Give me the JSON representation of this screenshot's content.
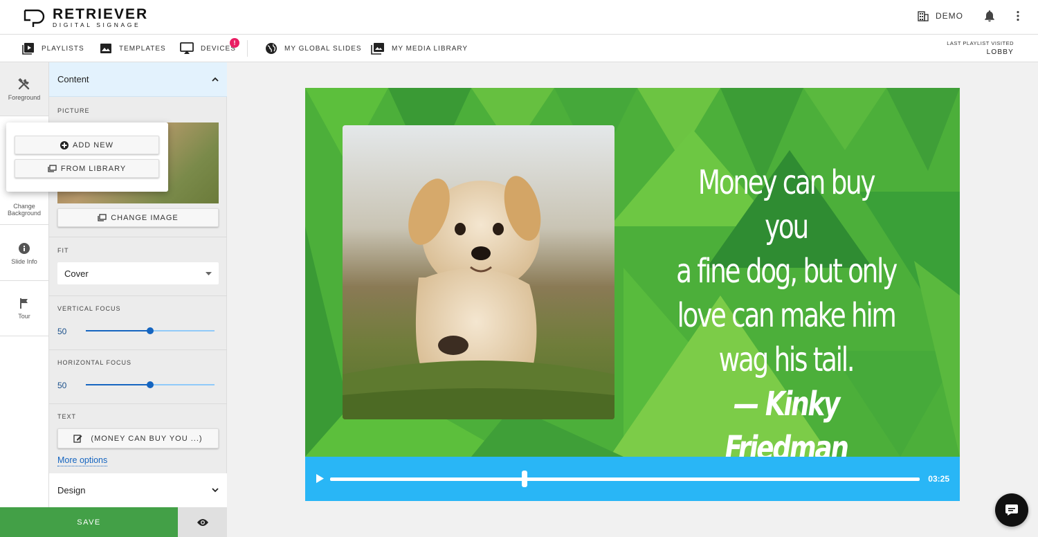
{
  "brand": {
    "title": "RETRIEVER",
    "subtitle": "DIGITAL SIGNAGE"
  },
  "header": {
    "org_label": "DEMO"
  },
  "nav": {
    "items": [
      {
        "label": "PLAYLISTS",
        "icon": "playlist-icon"
      },
      {
        "label": "TEMPLATES",
        "icon": "image-icon"
      },
      {
        "label": "DEVICES",
        "icon": "cast-icon",
        "badge": "!"
      },
      {
        "label": "MY GLOBAL SLIDES",
        "icon": "globe-icon"
      },
      {
        "label": "MY MEDIA LIBRARY",
        "icon": "media-library-icon"
      }
    ],
    "last_visited_label": "LAST PLAYLIST VISITED",
    "last_visited_value": "LOBBY"
  },
  "rail": {
    "foreground": "Foreground",
    "change_background": "Change Background",
    "slide_info": "Slide Info",
    "tour": "Tour"
  },
  "panel": {
    "content_title": "Content",
    "picture_label": "PICTURE",
    "add_new": "ADD NEW",
    "from_library": "FROM LIBRARY",
    "change_image": "CHANGE IMAGE",
    "fit_label": "FIT",
    "fit_value": "Cover",
    "vertical_focus_label": "VERTICAL FOCUS",
    "vertical_focus_value": 50,
    "horizontal_focus_label": "HORIZONTAL FOCUS",
    "horizontal_focus_value": 50,
    "text_label": "TEXT",
    "text_button": "(MONEY CAN BUY YOU ...)",
    "more_options": "More options",
    "design_title": "Design",
    "save": "SAVE"
  },
  "slide": {
    "quote_line1": "Money can buy you",
    "quote_line2": "a fine dog, but only",
    "quote_line3": "love can make him",
    "quote_line4": "wag his tail.",
    "author_prefix": "— ",
    "author": "Kinky Friedman"
  },
  "player": {
    "time": "03:25",
    "progress": 0.33
  },
  "colors": {
    "accent": "#43a047",
    "player": "#29b6f6",
    "badge": "#e91e63",
    "slider": "#1565c0"
  }
}
